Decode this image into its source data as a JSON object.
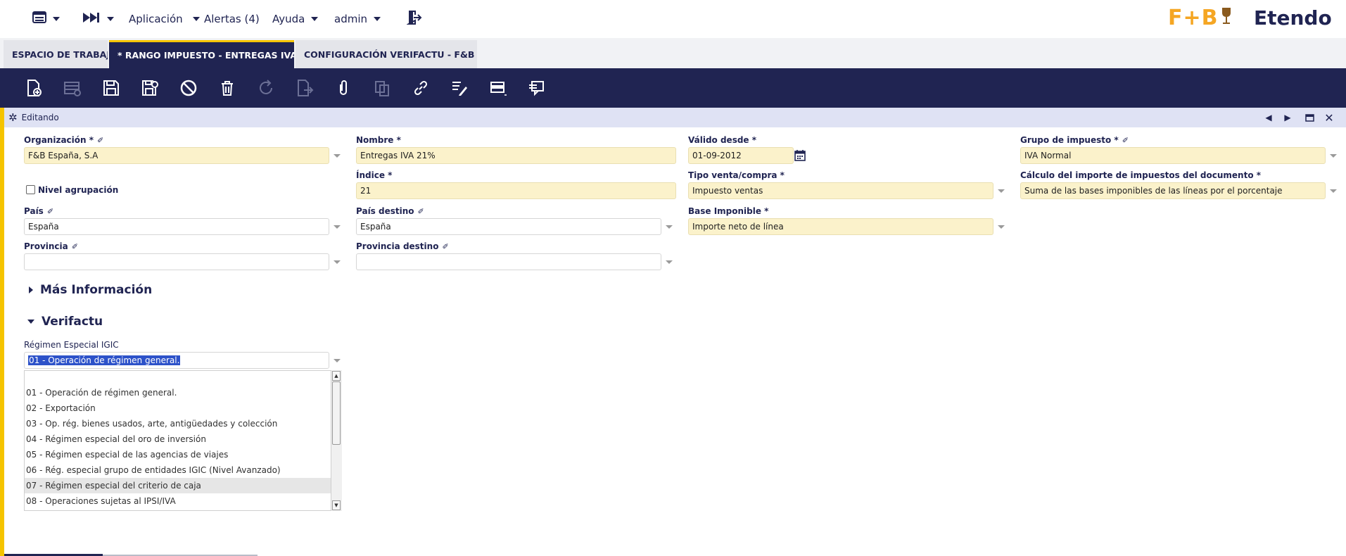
{
  "nav": {
    "application": "Aplicación",
    "alerts": "Alertas (4)",
    "help": "Ayuda",
    "user": "admin"
  },
  "brand": {
    "logo_text": "F+B",
    "name": "Etendo",
    "accent": "#f5a623"
  },
  "tabs": [
    {
      "label": "ESPACIO DE TRABAJO"
    },
    {
      "label": "* RANGO IMPUESTO - ENTREGAS IVA ...",
      "close": "×"
    },
    {
      "label": "CONFIGURACIÓN VERIFACTU - F&B ...",
      "close": "×"
    }
  ],
  "status": {
    "text": "Editando"
  },
  "form": {
    "organizacion": {
      "label": "Organización *",
      "value": "F&B España, S.A"
    },
    "nombre": {
      "label": "Nombre *",
      "value": "Entregas IVA 21%"
    },
    "valido_desde": {
      "label": "Válido desde *",
      "value": "01-09-2012"
    },
    "grupo_impuesto": {
      "label": "Grupo de impuesto *",
      "value": "IVA Normal"
    },
    "nivel_agrupacion": {
      "label": "Nivel agrupación"
    },
    "indice": {
      "label": "Índice *",
      "value": "21"
    },
    "tipo_venta": {
      "label": "Tipo venta/compra *",
      "value": "Impuesto ventas"
    },
    "calculo_importe": {
      "label": "Cálculo del importe de impuestos del documento *",
      "value": "Suma de las bases imponibles de las líneas por el porcentaje"
    },
    "pais": {
      "label": "País",
      "value": "España"
    },
    "pais_destino": {
      "label": "País destino",
      "value": "España"
    },
    "base_imponible": {
      "label": "Base Imponible *",
      "value": "Importe neto de línea"
    },
    "provincia": {
      "label": "Provincia",
      "value": ""
    },
    "provincia_destino": {
      "label": "Provincia destino",
      "value": ""
    }
  },
  "sections": {
    "mas_info": "Más Información",
    "verifactu": "Verifactu"
  },
  "regimen": {
    "label": "Régimen Especial IGIC",
    "value": "01 - Operación de régimen general.",
    "options": [
      "",
      "01 - Operación de régimen general.",
      "02 - Exportación",
      "03 - Op. rég. bienes usados, arte, antigüedades y colección",
      "04 - Régimen especial del oro de inversión",
      "05 - Régimen especial de las agencias de viajes",
      "06 - Rég. especial grupo de entidades IGIC (Nivel Avanzado)",
      "07 - Régimen especial del criterio de caja",
      "08 - Operaciones sujetas al IPSI/IVA"
    ],
    "highlighted_index": 7
  },
  "colors": {
    "navy": "#202452",
    "yellow": "#f5c400",
    "required_bg": "#fbf2cb"
  }
}
